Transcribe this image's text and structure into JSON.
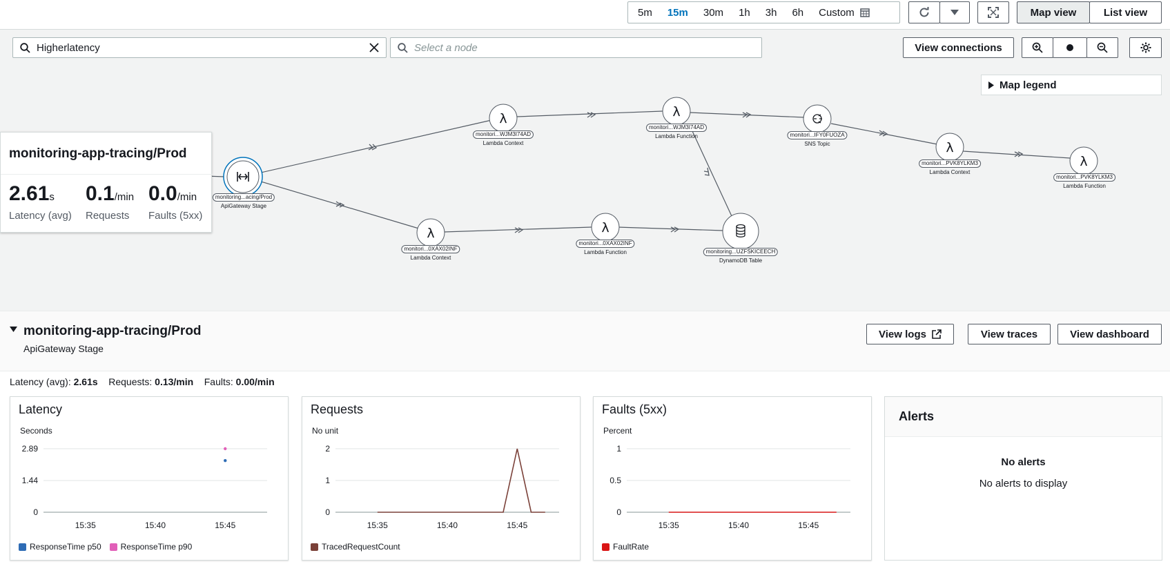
{
  "time_range": {
    "options": [
      "5m",
      "15m",
      "30m",
      "1h",
      "3h",
      "6h",
      "Custom"
    ],
    "selected": "15m"
  },
  "view_toggle": {
    "map_label": "Map view",
    "list_label": "List view",
    "selected": "Map view"
  },
  "search": {
    "value": "Higherlatency",
    "node_placeholder": "Select a node"
  },
  "map_toolbar": {
    "view_connections": "View connections"
  },
  "map_legend_label": "Map legend",
  "selected_card": {
    "title": "monitoring-app-tracing/Prod",
    "latency": {
      "value": "2.61",
      "unit": "s",
      "label": "Latency (avg)"
    },
    "requests": {
      "value": "0.1",
      "unit": "/min",
      "label": "Requests"
    },
    "faults": {
      "value": "0.0",
      "unit": "/min",
      "label": "Faults (5xx)"
    }
  },
  "nodes": [
    {
      "id": "monitoring...acing/Prod",
      "type": "ApiGateway Stage",
      "icon": "api-gateway-icon"
    },
    {
      "id": "monitori...WJM3I74AD",
      "type": "Lambda Context",
      "icon": "lambda-icon"
    },
    {
      "id": "monitori...WJM3I74AD",
      "type": "Lambda Function",
      "icon": "lambda-icon"
    },
    {
      "id": "monitori...IFY0FUOZA",
      "type": "SNS Topic",
      "icon": "sns-icon"
    },
    {
      "id": "monitori...PVK8YLKM3",
      "type": "Lambda Context",
      "icon": "lambda-icon"
    },
    {
      "id": "monitori...PVK8YLKM3",
      "type": "Lambda Function",
      "icon": "lambda-icon"
    },
    {
      "id": "monitori...0XAX02INF",
      "type": "Lambda Context",
      "icon": "lambda-icon"
    },
    {
      "id": "monitori...0XAX02INF",
      "type": "Lambda Function",
      "icon": "lambda-icon"
    },
    {
      "id": "monitoring...UZFSKICEECH",
      "type": "DynamoDB Table",
      "icon": "dynamodb-icon"
    }
  ],
  "details": {
    "title": "monitoring-app-tracing/Prod",
    "subtitle": "ApiGateway Stage",
    "view_logs": "View logs",
    "view_traces": "View traces",
    "view_dashboard": "View dashboard"
  },
  "summary": {
    "latency_label": "Latency (avg):",
    "latency_value": "2.61s",
    "requests_label": "Requests:",
    "requests_value": "0.13/min",
    "faults_label": "Faults:",
    "faults_value": "0.00/min"
  },
  "chart_data": [
    {
      "type": "scatter",
      "title": "Latency",
      "ylabel": "Seconds",
      "x_ticks": [
        "15:35",
        "15:40",
        "15:45"
      ],
      "y_ticks": [
        "2.89",
        "1.44",
        "0"
      ],
      "ylim": [
        0,
        2.89
      ],
      "series": [
        {
          "name": "ResponseTime p50",
          "color": "#2e6cb5",
          "points": [
            {
              "x": "15:45",
              "y": 2.35
            }
          ]
        },
        {
          "name": "ResponseTime p90",
          "color": "#e15fb8",
          "points": [
            {
              "x": "15:45",
              "y": 2.89
            }
          ]
        }
      ]
    },
    {
      "type": "line",
      "title": "Requests",
      "ylabel": "No unit",
      "x_ticks": [
        "15:35",
        "15:40",
        "15:45"
      ],
      "y_ticks": [
        "2",
        "1",
        "0"
      ],
      "ylim": [
        0,
        2
      ],
      "series": [
        {
          "name": "TracedRequestCount",
          "color": "#7a4038",
          "points": [
            {
              "x": "15:35",
              "y": 0
            },
            {
              "x": "15:44",
              "y": 0
            },
            {
              "x": "15:45",
              "y": 2
            },
            {
              "x": "15:46",
              "y": 0
            },
            {
              "x": "15:47",
              "y": 0
            }
          ]
        }
      ]
    },
    {
      "type": "line",
      "title": "Faults (5xx)",
      "ylabel": "Percent",
      "x_ticks": [
        "15:35",
        "15:40",
        "15:45"
      ],
      "y_ticks": [
        "1",
        "0.5",
        "0"
      ],
      "ylim": [
        0,
        1
      ],
      "series": [
        {
          "name": "FaultRate",
          "color": "#d91515",
          "points": [
            {
              "x": "15:35",
              "y": 0
            },
            {
              "x": "15:47",
              "y": 0
            }
          ]
        }
      ]
    }
  ],
  "alerts": {
    "title": "Alerts",
    "empty_title": "No alerts",
    "empty_text": "No alerts to display"
  }
}
